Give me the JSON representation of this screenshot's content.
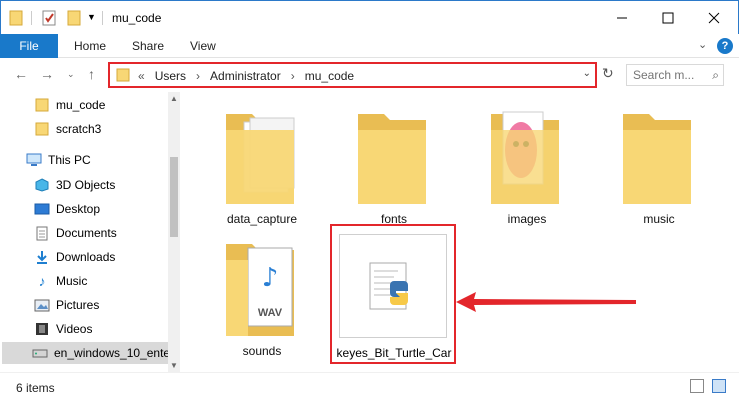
{
  "window": {
    "title": "mu_code",
    "minimize_icon": "minimize-icon",
    "maximize_icon": "maximize-icon",
    "close_icon": "close-icon"
  },
  "ribbon": {
    "tabs": [
      "File",
      "Home",
      "Share",
      "View"
    ],
    "help_label": "?"
  },
  "address": {
    "crumbs": [
      "«",
      "Users",
      "›",
      "Administrator",
      "›",
      "mu_code"
    ],
    "search_placeholder": "Search m..."
  },
  "sidebar": {
    "items": [
      {
        "label": "mu_code",
        "icon": "folder-icon"
      },
      {
        "label": "scratch3",
        "icon": "folder-icon"
      },
      {
        "label": "This PC",
        "icon": "computer-icon"
      },
      {
        "label": "3D Objects",
        "icon": "cube-icon"
      },
      {
        "label": "Desktop",
        "icon": "desktop-icon"
      },
      {
        "label": "Documents",
        "icon": "documents-icon"
      },
      {
        "label": "Downloads",
        "icon": "download-icon"
      },
      {
        "label": "Music",
        "icon": "music-icon"
      },
      {
        "label": "Pictures",
        "icon": "pictures-icon"
      },
      {
        "label": "Videos",
        "icon": "videos-icon"
      },
      {
        "label": "en_windows_10_ente",
        "icon": "drive-icon"
      }
    ]
  },
  "files": [
    {
      "name": "data_capture",
      "type": "folder-with-documents"
    },
    {
      "name": "fonts",
      "type": "folder"
    },
    {
      "name": "images",
      "type": "folder-with-images"
    },
    {
      "name": "music",
      "type": "folder"
    },
    {
      "name": "sounds",
      "type": "folder-with-wav"
    },
    {
      "name": "keyes_Bit_Turtle_Car",
      "type": "python-file"
    }
  ],
  "status": {
    "item_count": "6 items"
  },
  "colors": {
    "accent": "#1979ca",
    "highlight": "#e3262b",
    "folder": "#f8d775"
  }
}
